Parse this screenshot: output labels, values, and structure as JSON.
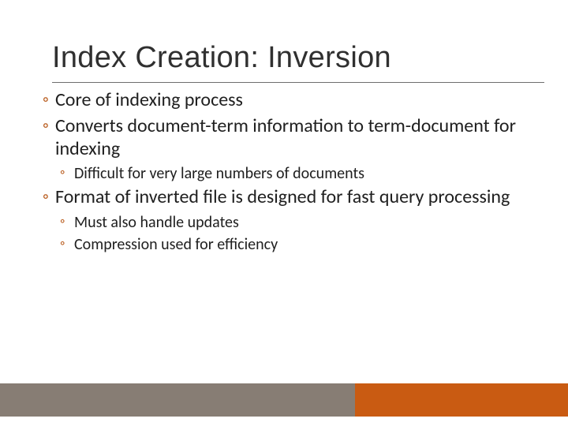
{
  "title": "Index Creation: Inversion",
  "bullets": [
    {
      "text": "Core of indexing process",
      "sub": []
    },
    {
      "text": "Converts document-term information to term-document for indexing",
      "sub": [
        "Difficult for very large numbers of documents"
      ]
    },
    {
      "text": "Format of inverted file is designed for fast query processing",
      "sub": [
        "Must also handle updates",
        "Compression used for efficiency"
      ]
    }
  ],
  "theme": {
    "accent": "#c95b12",
    "band_gray": "#877d74",
    "bullet_color": "#b85a1b",
    "rule_color": "#6e6e6e"
  }
}
